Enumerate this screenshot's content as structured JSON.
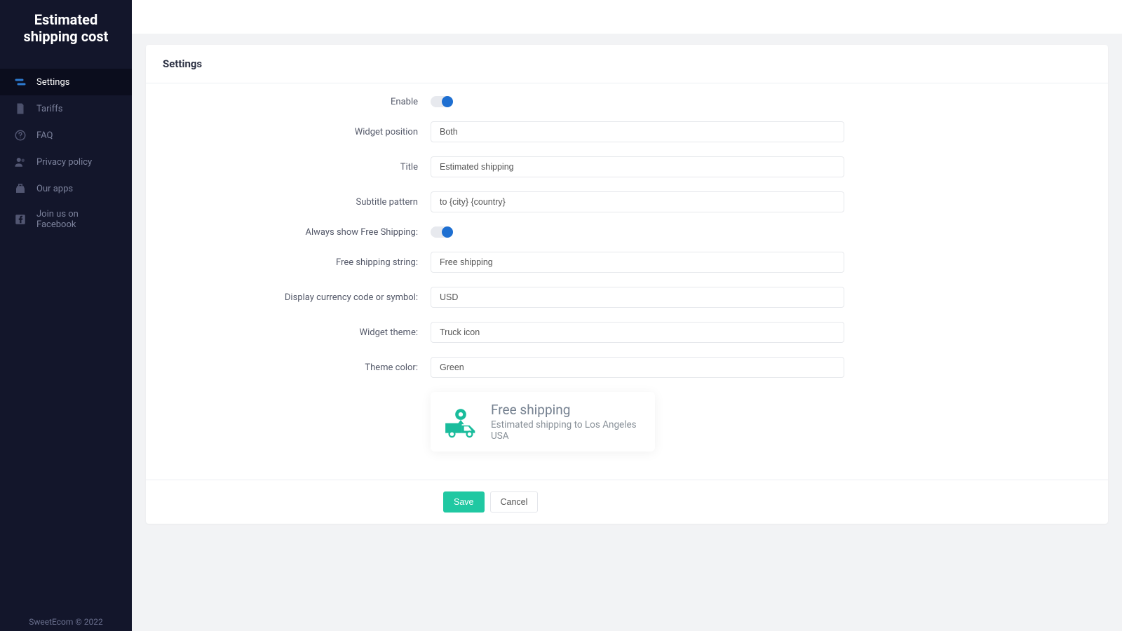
{
  "app_title": "Estimated shipping cost",
  "sidebar": {
    "items": [
      {
        "label": "Settings",
        "icon": "settings-icon"
      },
      {
        "label": "Tariffs",
        "icon": "tariffs-icon"
      },
      {
        "label": "FAQ",
        "icon": "faq-icon"
      },
      {
        "label": "Privacy policy",
        "icon": "privacy-icon"
      },
      {
        "label": "Our apps",
        "icon": "apps-icon"
      },
      {
        "label": "Join us on Facebook",
        "icon": "facebook-icon"
      }
    ],
    "active_index": 0,
    "footer": "SweetEcom © 2022"
  },
  "card": {
    "title": "Settings",
    "fields": {
      "enable": {
        "label": "Enable",
        "value": true
      },
      "position": {
        "label": "Widget position",
        "value": "Both"
      },
      "title": {
        "label": "Title",
        "value": "Estimated shipping"
      },
      "subtitle": {
        "label": "Subtitle pattern",
        "value": "to {city} {country}"
      },
      "always_free": {
        "label": "Always show Free Shipping:",
        "value": true
      },
      "free_string": {
        "label": "Free shipping string:",
        "value": "Free shipping"
      },
      "currency": {
        "label": "Display currency code or symbol:",
        "value": "USD"
      },
      "theme": {
        "label": "Widget theme:",
        "value": "Truck icon"
      },
      "color": {
        "label": "Theme color:",
        "value": "Green"
      }
    },
    "preview": {
      "title": "Free shipping",
      "subtitle": "Estimated shipping to Los Angeles USA",
      "theme_color": "#1abc9c"
    },
    "actions": {
      "save": "Save",
      "cancel": "Cancel"
    }
  }
}
